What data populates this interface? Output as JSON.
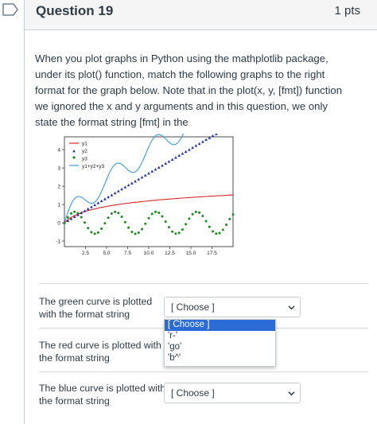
{
  "header": {
    "title": "Question 19",
    "points": "1 pts"
  },
  "question_text": "When you plot graphs in Python using the mathplotlib package, under its plot() function, match the following graphs to the right format for the graph below. Note that in the plot(x, y, [fmt]) function we ignored the x and y arguments and in this question, we only state the format string [fmt] in the",
  "chart_data": {
    "type": "line",
    "x_ticks": [
      "2.5",
      "5.0",
      "7.5",
      "10.0",
      "12.5",
      "15.0",
      "17.5"
    ],
    "y_ticks": [
      "-1",
      "0",
      "1",
      "2",
      "3",
      "4"
    ],
    "legend": [
      "y1",
      "y2",
      "y3",
      "y1+y2+y3"
    ],
    "legend_position": "top-left",
    "series_colors": {
      "y1": "#d62728",
      "y2": "#1f2aa8",
      "y3": "#1a8a1a",
      "sum": "#3a9bd8"
    }
  },
  "matches": [
    {
      "label": "The green curve is plotted with the format string",
      "selected": "[ Choose ]"
    },
    {
      "label": "The red curve is plotted with the format string",
      "selected": ""
    },
    {
      "label": "The blue curve is plotted with the format string",
      "selected": "[ Choose ]"
    }
  ],
  "dropdown_options": [
    "[ Choose ]",
    "'r-'",
    "'go'",
    "'b^'"
  ]
}
